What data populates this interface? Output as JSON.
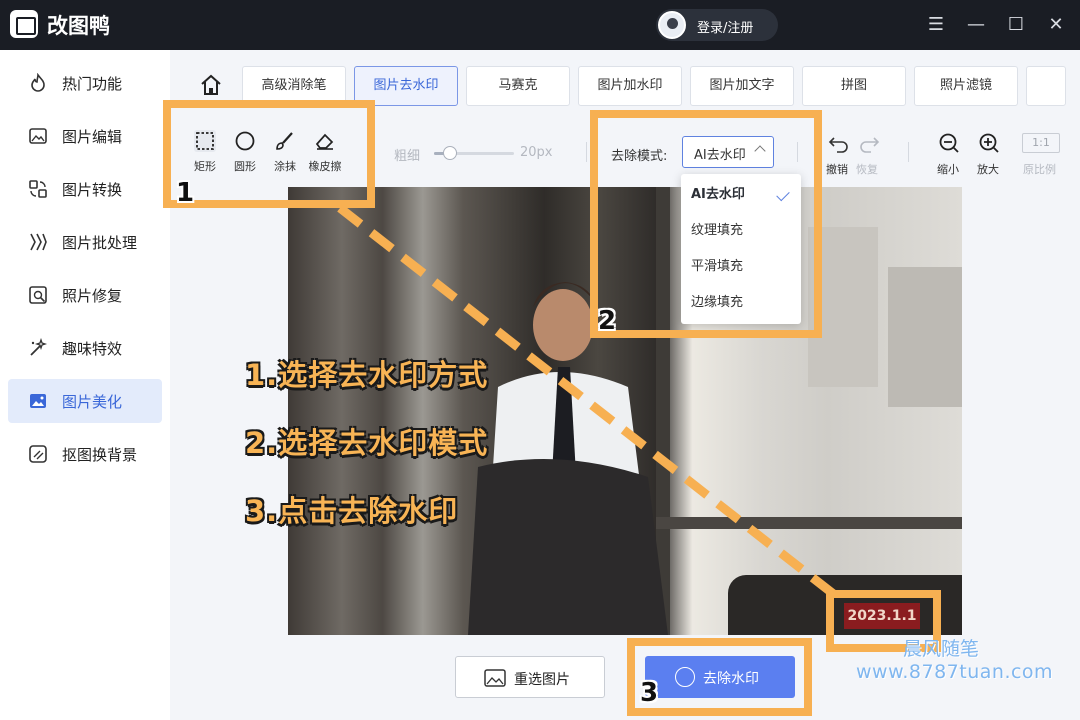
{
  "titlebar": {
    "app_name": "改图鸭",
    "login_label": "登录/注册",
    "menu_icon": "menu-icon",
    "minimize_icon": "minimize-icon",
    "maximize_icon": "maximize-icon",
    "close_icon": "close-icon"
  },
  "sidebar": {
    "items": [
      {
        "label": "热门功能",
        "icon": "fire-icon"
      },
      {
        "label": "图片编辑",
        "icon": "image-edit-icon"
      },
      {
        "label": "图片转换",
        "icon": "convert-icon"
      },
      {
        "label": "图片批处理",
        "icon": "batch-icon"
      },
      {
        "label": "照片修复",
        "icon": "repair-icon"
      },
      {
        "label": "趣味特效",
        "icon": "sparkle-icon"
      },
      {
        "label": "图片美化",
        "icon": "beautify-icon",
        "active": true
      },
      {
        "label": "抠图换背景",
        "icon": "cutout-icon"
      }
    ]
  },
  "tabs": [
    {
      "label": "高级消除笔"
    },
    {
      "label": "图片去水印",
      "active": true
    },
    {
      "label": "马赛克"
    },
    {
      "label": "图片加水印"
    },
    {
      "label": "图片加文字"
    },
    {
      "label": "拼图"
    },
    {
      "label": "照片滤镜"
    }
  ],
  "toolbar": {
    "tools": [
      {
        "label": "矩形",
        "icon": "rectangle-select-icon",
        "selected": true
      },
      {
        "label": "圆形",
        "icon": "circle-select-icon"
      },
      {
        "label": "涂抹",
        "icon": "brush-icon"
      },
      {
        "label": "橡皮擦",
        "icon": "eraser-icon"
      }
    ],
    "thickness_label": "粗细",
    "thickness_value": "20px",
    "thickness_fraction": 0.2,
    "mode_label": "去除模式:",
    "mode_value": "AI去水印",
    "undo_label": "撤销",
    "redo_label": "恢复",
    "zoom_out_label": "缩小",
    "zoom_in_label": "放大",
    "ratio_box": "1:1",
    "ratio_label": "原比例"
  },
  "dropdown": {
    "options": [
      "AI去水印",
      "纹理填充",
      "平滑填充",
      "边缘填充"
    ],
    "selected": "AI去水印"
  },
  "canvas": {
    "date_stamp": "2023.1.1"
  },
  "buttons": {
    "reselect_label": "重选图片",
    "remove_label": "去除水印"
  },
  "annotations": {
    "num1": "1",
    "num2": "2",
    "num3": "3",
    "step1": "1.选择去水印方式",
    "step2": "2.选择去水印模式",
    "step3": "3.点击去除水印",
    "accent_color": "#f7b052"
  },
  "watermark": {
    "line1": "晨风随笔",
    "line2": "www.8787tuan.com"
  }
}
